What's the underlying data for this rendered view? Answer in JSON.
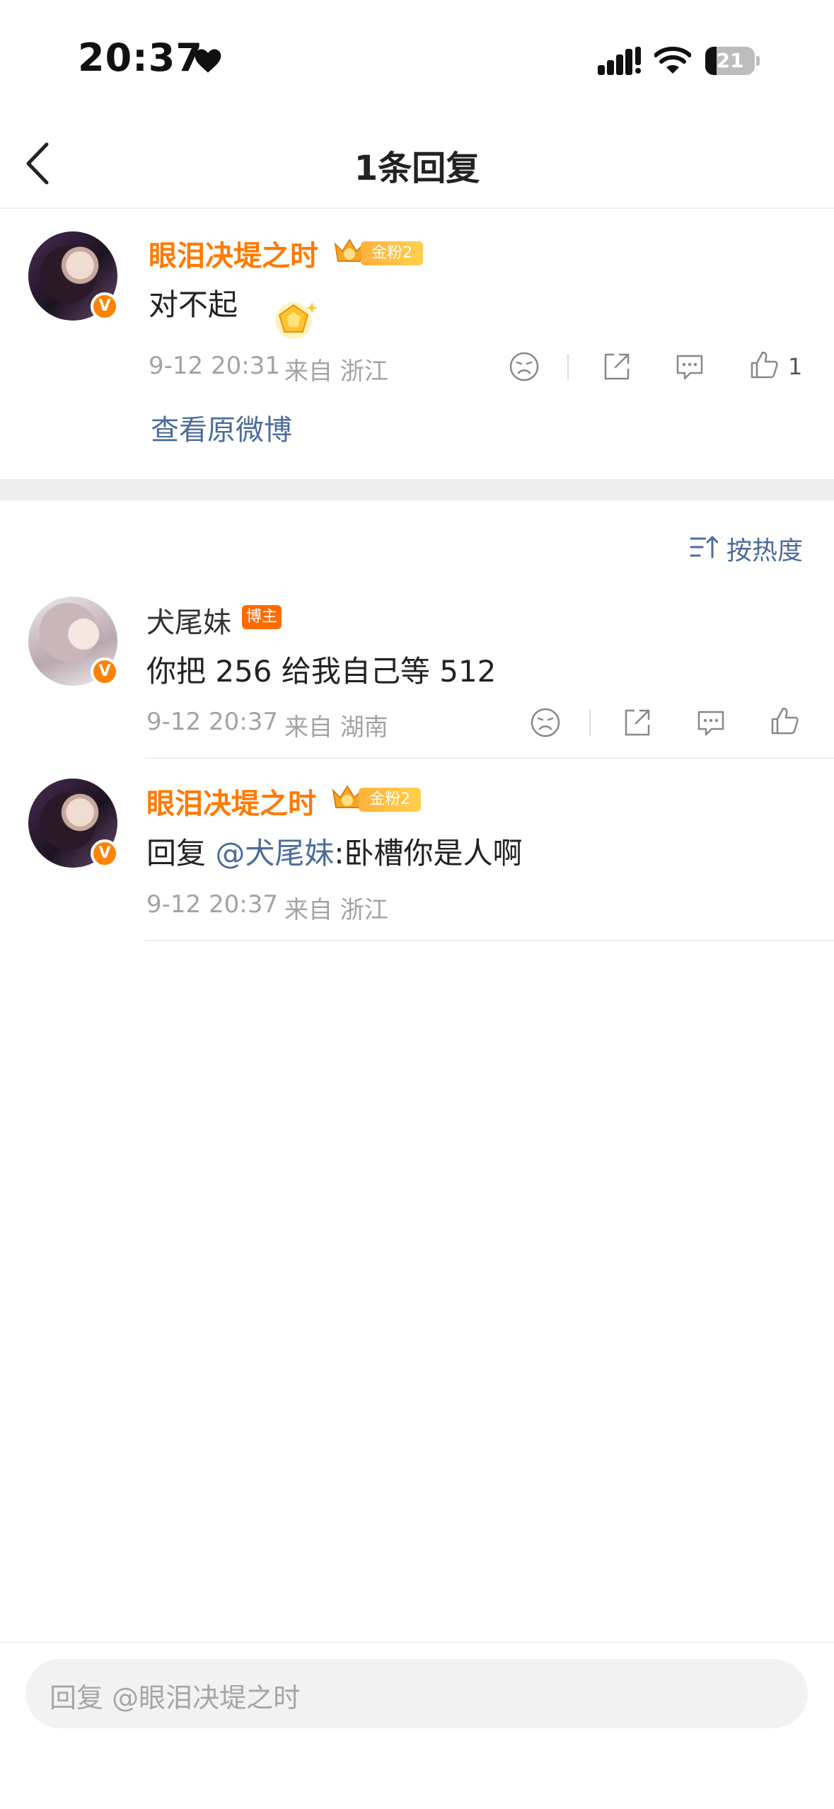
{
  "status_bar": {
    "time": "20:37",
    "battery": "21"
  },
  "header": {
    "title": "1条回复"
  },
  "original_comment": {
    "username": "眼泪决堤之时",
    "fan_badge": "金粉2",
    "text": "对不起",
    "date": "9-12 20:31",
    "source": "来自 浙江",
    "like_count": "1",
    "view_original": "查看原微博"
  },
  "sort": {
    "label": "按热度"
  },
  "replies": [
    {
      "username": "犬尾妹",
      "badge": "博主",
      "text": "你把 256 给我自己等 512",
      "date": "9-12 20:37",
      "source": "来自 湖南"
    },
    {
      "username": "眼泪决堤之时",
      "fan_badge": "金粉2",
      "prefix": "回复 ",
      "mention": "@犬尾妹",
      "text": ":卧槽你是人啊",
      "date": "9-12 20:37",
      "source": "来自 浙江"
    }
  ],
  "reply_bar": {
    "placeholder": "回复 @眼泪决堤之时"
  },
  "colors": {
    "accent": "#ff7a00",
    "link": "#4c6c9c",
    "meta": "#a3a3a3",
    "divider": "#eeeeee"
  }
}
